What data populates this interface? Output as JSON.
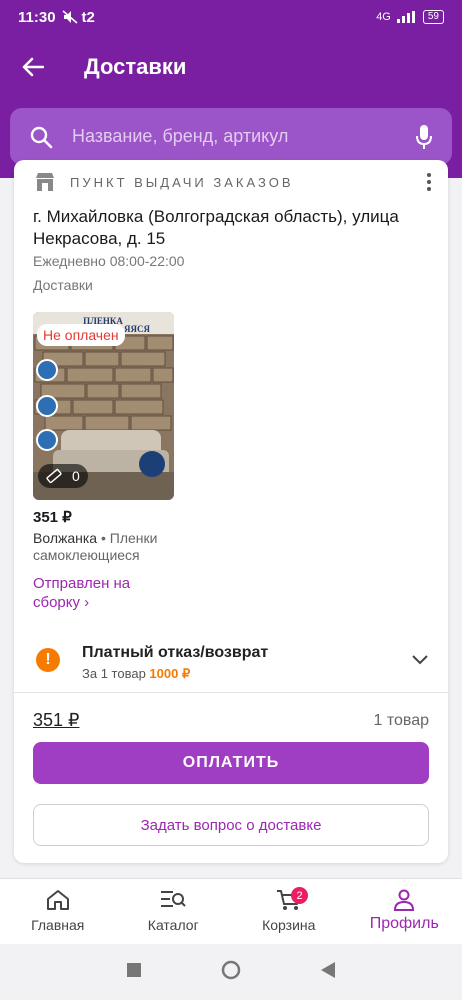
{
  "status_bar": {
    "time": "11:30",
    "carrier": "t2",
    "network": "4G",
    "battery": "59"
  },
  "header": {
    "title": "Доставки"
  },
  "search": {
    "placeholder": "Название, бренд, артикул"
  },
  "pickup": {
    "label": "ПУНКТ ВЫДАЧИ ЗАКАЗОВ",
    "address": "г. Михайловка (Волгоградская область), улица Некрасова, д. 15",
    "hours": "Ежедневно 08:00-22:00",
    "section_label": "Доставки"
  },
  "product": {
    "badge": "Не оплачен",
    "rating_count": "0",
    "price": "351 ₽",
    "brand": "Волжанка",
    "category": "Пленки самоклеющиеся",
    "status": "Отправлен на сборку ›",
    "image_text_top": "ПЛЕНКА",
    "image_text_top2": "ЯЯСЯ"
  },
  "refund": {
    "title": "Платный отказ/возврат",
    "sub_prefix": "За 1 товар",
    "amount": "1000 ₽"
  },
  "summary": {
    "total": "351 ₽",
    "count": "1 товар"
  },
  "buttons": {
    "pay": "ОПЛАТИТЬ",
    "ask": "Задать вопрос о доставке"
  },
  "nav": {
    "items": [
      {
        "label": "Главная",
        "icon": "home-icon"
      },
      {
        "label": "Каталог",
        "icon": "catalog-icon"
      },
      {
        "label": "Корзина",
        "icon": "cart-icon",
        "badge": "2"
      },
      {
        "label": "Профиль",
        "icon": "profile-icon"
      }
    ]
  },
  "colors": {
    "brand": "#7b1fa2",
    "accent": "#9c27b0",
    "orange": "#f57c00",
    "error": "#e53935"
  }
}
